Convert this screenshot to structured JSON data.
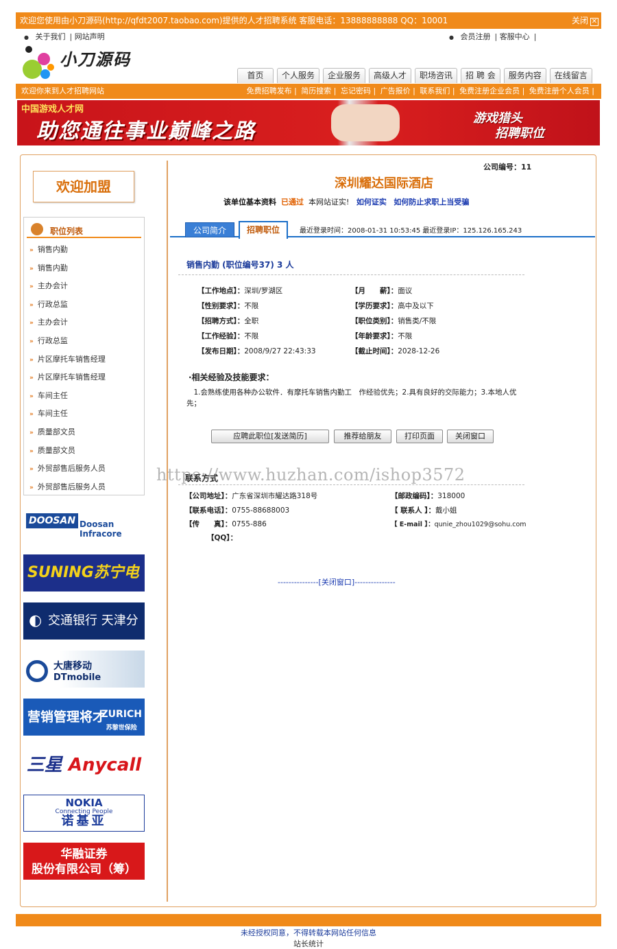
{
  "topbar": {
    "welcome": "欢迎您使用由小刀源码(http://qfdt2007.taobao.com)提供的人才招聘系统 客服电话：13888888888 QQ：10001",
    "close": "关闭"
  },
  "toplinks": [
    "关于我们",
    "网站声明"
  ],
  "rightlinks": [
    "会员注册",
    "客服中心"
  ],
  "logo": {
    "name": "小刀源码"
  },
  "nav": [
    "首页",
    "个人服务",
    "企业服务",
    "高级人才",
    "职场咨讯",
    "招 聘 会",
    "服务内容",
    "在线留言"
  ],
  "subbar": {
    "welcome": "欢迎你来到人才招聘网站",
    "links": [
      "免费招聘发布",
      "简历搜索",
      "忘记密码",
      "广告报价",
      "联系我们",
      "免费注册企业会员",
      "免费注册个人会员"
    ]
  },
  "banner": {
    "tag": "中国游戏人才网",
    "slogan": "助您通往事业巅峰之路",
    "right1": "游戏猎头",
    "right2": "招聘职位"
  },
  "sidebar": {
    "welcome": "欢迎加盟",
    "joblist_title": "职位列表",
    "jobs": [
      "销售内勤",
      "销售内勤",
      "主办会计",
      "行政总监",
      "主办会计",
      "行政总监",
      "片区摩托车销售经理",
      "片区摩托车销售经理",
      "车间主任",
      "车间主任",
      "质量部文员",
      "质量部文员",
      "外贸部售后服务人员",
      "外贸部售后服务人员"
    ]
  },
  "ads": {
    "doosan_logo": "DOOSAN",
    "doosan_text": "Doosan Infracore",
    "suning": "SUNING苏宁电器",
    "bocom": "交通银行 天津分行",
    "dtmobile_cn": "大唐移动",
    "dtmobile_en": "DTmobile",
    "zurich_left": "营销管理将才",
    "zurich_right": "ZURICH",
    "zurich_sub": "苏黎世保险",
    "samsung_cn": "三星",
    "samsung_en": "Anycall",
    "nokia": "NOKIA",
    "nokia_sub": "Connecting People",
    "nokia_cn": "诺基亚",
    "huarong1": "华融证券",
    "huarong2": "股份有限公司（筹）"
  },
  "company": {
    "number_label": "公司编号：",
    "number": "11",
    "name": "深圳耀达国际酒店",
    "verify_prefix": "该单位基本资料",
    "verify_status": "已通过",
    "verify_suffix": "本网站证实!",
    "how_verify": "如何证实",
    "how_prevent": "如何防止求职上当受骗"
  },
  "tabs": {
    "intro": "公司简介",
    "jobs": "招聘职位"
  },
  "last_login": "最近登录时间：2008-01-31 10:53:45  最近登录IP：125.126.165.243",
  "job": {
    "title": "销售内勤 (职位编号37) 3 人",
    "fields_left": [
      {
        "label": "【工作地点】：",
        "value": "深圳/罗湖区"
      },
      {
        "label": "【性别要求】：",
        "value": "不限"
      },
      {
        "label": "【招聘方式】：",
        "value": "全职"
      },
      {
        "label": "【工作经验】：",
        "value": "不限"
      },
      {
        "label": "【发布日期】：",
        "value": "2008/9/27 22:43:33"
      }
    ],
    "fields_right": [
      {
        "label": "【月　　薪】：",
        "value": "面议"
      },
      {
        "label": "【学历要求】：",
        "value": "高中及以下"
      },
      {
        "label": "【职位类别】：",
        "value": "销售类/不限"
      },
      {
        "label": "【年龄要求】：",
        "value": "不限"
      },
      {
        "label": "【截止时间】：",
        "value": "2028-12-26"
      }
    ],
    "req_title": "·相关经验及技能要求：",
    "req_text": "　1.会熟练使用各种办公软件．有摩托车销售内勤工　作经验优先；2.具有良好的交际能力；3.本地人优先；"
  },
  "buttons": {
    "apply": "应聘此职位[发送简历]",
    "recommend": "推荐给朋友",
    "print": "打印页面",
    "close": "关闭窗口"
  },
  "contact": {
    "title": "联系方式",
    "watermark": "https://www.huzhan.com/ishop3572",
    "address_label": "【公司地址】：",
    "address": "广东省深圳市耀达路318号",
    "postcode_label": "【邮政编码】：",
    "postcode": "318000",
    "phone_label": "【联系电话】：",
    "phone": "0755-88688003",
    "person_label": "【 联系人 】：",
    "person": "戴小姐",
    "fax_label": "【传　　真】：",
    "fax": "0755-886",
    "email_label": "【 E-mail 】：",
    "email": "qunie_zhou1029@sohu.com",
    "qq_label": "【QQ】："
  },
  "close_window": "---------------[关闭窗口]---------------",
  "footer": {
    "line1": "未经授权同意，不得转载本网站任何信息",
    "line2": "站长统计"
  }
}
